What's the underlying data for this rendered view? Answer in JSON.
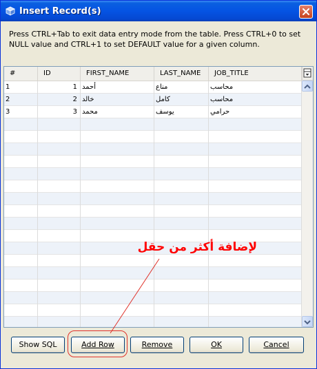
{
  "window": {
    "title": "Insert Record(s)",
    "close_label": "close",
    "info_text": "Press CTRL+Tab to exit data entry mode from the table. Press CTRL+0 to set NULL value and CTRL+1 to set DEFAULT value for a given column."
  },
  "grid": {
    "columns": [
      "#",
      "ID",
      "FIRST_NAME",
      "LAST_NAME",
      "JOB_TITLE"
    ],
    "rows": [
      {
        "num": "1",
        "id": "1",
        "first": "أحمد",
        "last": "مناع",
        "job": "محاسب"
      },
      {
        "num": "2",
        "id": "2",
        "first": "خالد",
        "last": "كامل",
        "job": "محاسب"
      },
      {
        "num": "3",
        "id": "3",
        "first": "محمد",
        "last": "يوسف",
        "job": "حرامي"
      }
    ]
  },
  "buttons": {
    "show_sql": "Show SQL",
    "add_row": "Add Row",
    "remove": "Remove",
    "ok": "OK",
    "cancel": "Cancel"
  },
  "annotation": {
    "text": "لإضافة أكثر من حقل",
    "color": "#ff0000"
  },
  "colors": {
    "title_bar": "#0554e3",
    "window_bg": "#ece9d8",
    "row_alt": "#edf2f9"
  }
}
